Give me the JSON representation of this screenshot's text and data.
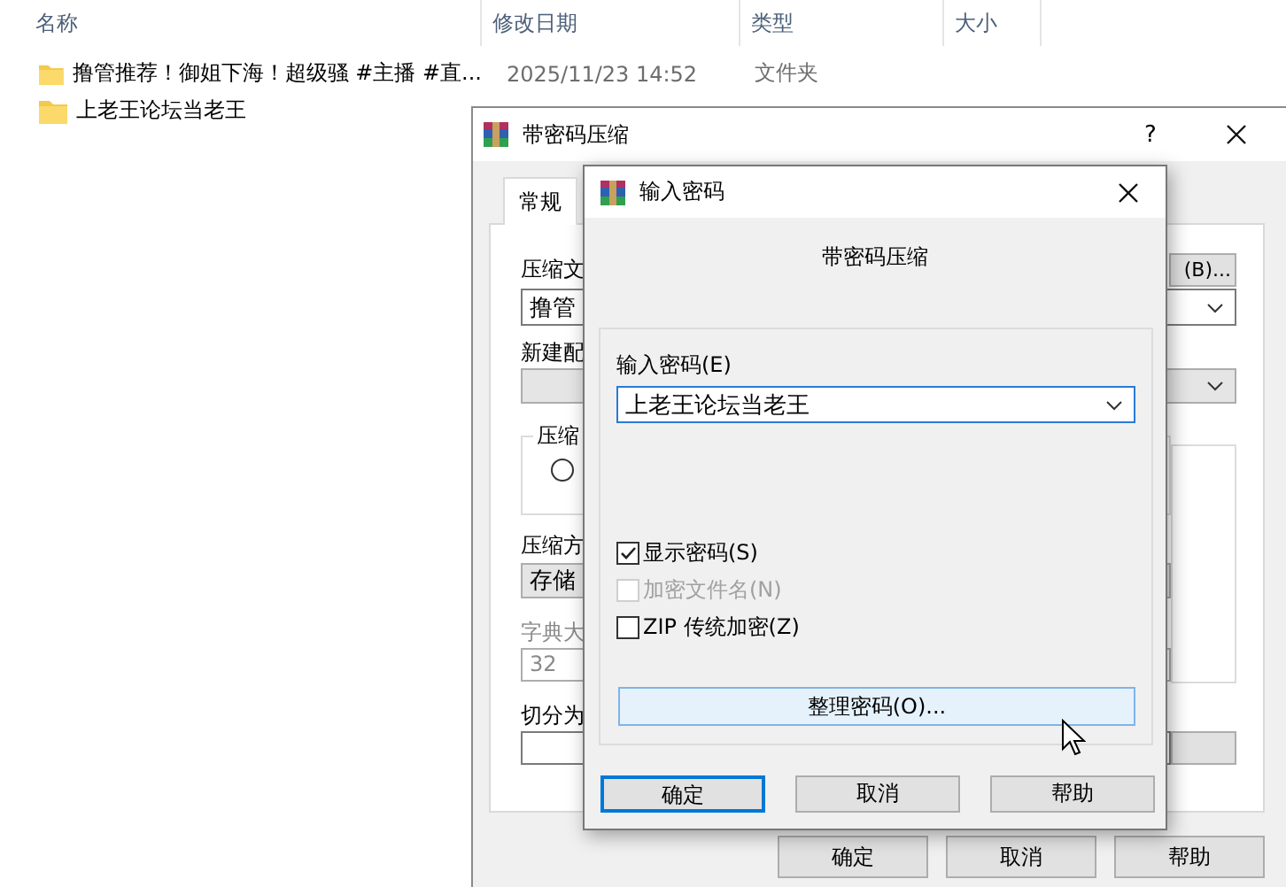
{
  "explorer": {
    "columns": [
      "名称",
      "修改日期",
      "类型",
      "大小"
    ],
    "rows": [
      {
        "name": "撸管推荐！御姐下海！超级骚 #主播 #直...",
        "modified": "2025/11/23 14:52",
        "type": "文件夹"
      },
      {
        "name": "上老王论坛当老王"
      }
    ]
  },
  "compress_dialog": {
    "title": "带密码压缩",
    "help": "?",
    "tabs": [
      {
        "label": "常规",
        "selected": true
      }
    ],
    "archive_name_label": "压缩文",
    "browse_button": "(B)...",
    "archive_name": "撸管",
    "profile_label": "新建配",
    "format_group": "压缩",
    "format_options": [
      {
        "selected": false
      }
    ],
    "method_label": "压缩方",
    "method": "存储",
    "dictionary_label": "字典大",
    "dictionary": "32",
    "split_label": "切分为",
    "buttons": [
      "确定",
      "取消",
      "帮助"
    ]
  },
  "password_dialog": {
    "title": "输入密码",
    "heading": "带密码压缩",
    "password_label": "输入密码(E)",
    "password": "上老王论坛当老王",
    "options": [
      {
        "label": "显示密码(S)",
        "checked": true,
        "disabled": false
      },
      {
        "label": "加密文件名(N)",
        "checked": false,
        "disabled": true
      },
      {
        "label": "ZIP 传统加密(Z)",
        "checked": false,
        "disabled": false
      }
    ],
    "organize_button": "整理密码(O)...",
    "buttons": [
      {
        "label": "确定",
        "default": true
      },
      {
        "label": "取消",
        "default": false
      },
      {
        "label": "帮助",
        "default": false
      }
    ]
  }
}
